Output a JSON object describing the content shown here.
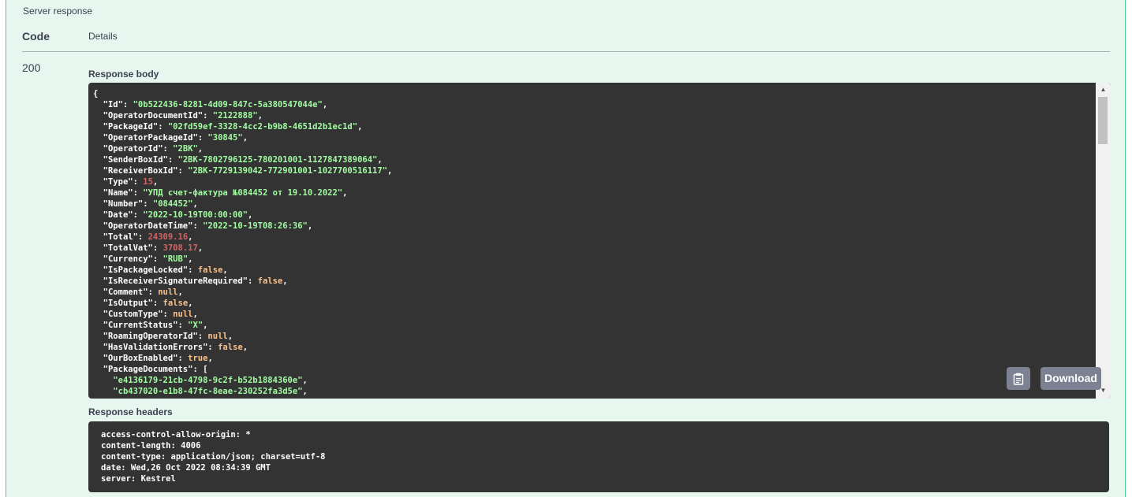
{
  "server_response": {
    "title": "Server response",
    "col_code": "Code",
    "col_details": "Details"
  },
  "response": {
    "code": "200",
    "body_label": "Response body",
    "headers_label": "Response headers",
    "download_label": "Download",
    "copy_icon": "clipboard-icon",
    "body_lines": [
      [
        {
          "t": "p",
          "v": "{"
        }
      ],
      [
        {
          "t": "p",
          "v": "  "
        },
        {
          "t": "k",
          "v": "\"Id\""
        },
        {
          "t": "p",
          "v": ": "
        },
        {
          "t": "s",
          "v": "\"0b522436-8281-4d09-847c-5a380547044e\""
        },
        {
          "t": "p",
          "v": ","
        }
      ],
      [
        {
          "t": "p",
          "v": "  "
        },
        {
          "t": "k",
          "v": "\"OperatorDocumentId\""
        },
        {
          "t": "p",
          "v": ": "
        },
        {
          "t": "s",
          "v": "\"2122888\""
        },
        {
          "t": "p",
          "v": ","
        }
      ],
      [
        {
          "t": "p",
          "v": "  "
        },
        {
          "t": "k",
          "v": "\"PackageId\""
        },
        {
          "t": "p",
          "v": ": "
        },
        {
          "t": "s",
          "v": "\"02fd59ef-3328-4cc2-b9b8-4651d2b1ec1d\""
        },
        {
          "t": "p",
          "v": ","
        }
      ],
      [
        {
          "t": "p",
          "v": "  "
        },
        {
          "t": "k",
          "v": "\"OperatorPackageId\""
        },
        {
          "t": "p",
          "v": ": "
        },
        {
          "t": "s",
          "v": "\"30845\""
        },
        {
          "t": "p",
          "v": ","
        }
      ],
      [
        {
          "t": "p",
          "v": "  "
        },
        {
          "t": "k",
          "v": "\"OperatorId\""
        },
        {
          "t": "p",
          "v": ": "
        },
        {
          "t": "s",
          "v": "\"2BK\""
        },
        {
          "t": "p",
          "v": ","
        }
      ],
      [
        {
          "t": "p",
          "v": "  "
        },
        {
          "t": "k",
          "v": "\"SenderBoxId\""
        },
        {
          "t": "p",
          "v": ": "
        },
        {
          "t": "s",
          "v": "\"2BK-7802796125-780201001-1127847389064\""
        },
        {
          "t": "p",
          "v": ","
        }
      ],
      [
        {
          "t": "p",
          "v": "  "
        },
        {
          "t": "k",
          "v": "\"ReceiverBoxId\""
        },
        {
          "t": "p",
          "v": ": "
        },
        {
          "t": "s",
          "v": "\"2BK-7729139042-772901001-1027700516117\""
        },
        {
          "t": "p",
          "v": ","
        }
      ],
      [
        {
          "t": "p",
          "v": "  "
        },
        {
          "t": "k",
          "v": "\"Type\""
        },
        {
          "t": "p",
          "v": ": "
        },
        {
          "t": "n",
          "v": "15"
        },
        {
          "t": "p",
          "v": ","
        }
      ],
      [
        {
          "t": "p",
          "v": "  "
        },
        {
          "t": "k",
          "v": "\"Name\""
        },
        {
          "t": "p",
          "v": ": "
        },
        {
          "t": "s",
          "v": "\"УПД счет-фактура №084452 от 19.10.2022\""
        },
        {
          "t": "p",
          "v": ","
        }
      ],
      [
        {
          "t": "p",
          "v": "  "
        },
        {
          "t": "k",
          "v": "\"Number\""
        },
        {
          "t": "p",
          "v": ": "
        },
        {
          "t": "s",
          "v": "\"084452\""
        },
        {
          "t": "p",
          "v": ","
        }
      ],
      [
        {
          "t": "p",
          "v": "  "
        },
        {
          "t": "k",
          "v": "\"Date\""
        },
        {
          "t": "p",
          "v": ": "
        },
        {
          "t": "s",
          "v": "\"2022-10-19T00:00:00\""
        },
        {
          "t": "p",
          "v": ","
        }
      ],
      [
        {
          "t": "p",
          "v": "  "
        },
        {
          "t": "k",
          "v": "\"OperatorDateTime\""
        },
        {
          "t": "p",
          "v": ": "
        },
        {
          "t": "s",
          "v": "\"2022-10-19T08:26:36\""
        },
        {
          "t": "p",
          "v": ","
        }
      ],
      [
        {
          "t": "p",
          "v": "  "
        },
        {
          "t": "k",
          "v": "\"Total\""
        },
        {
          "t": "p",
          "v": ": "
        },
        {
          "t": "n",
          "v": "24309.16"
        },
        {
          "t": "p",
          "v": ","
        }
      ],
      [
        {
          "t": "p",
          "v": "  "
        },
        {
          "t": "k",
          "v": "\"TotalVat\""
        },
        {
          "t": "p",
          "v": ": "
        },
        {
          "t": "n",
          "v": "3708.17"
        },
        {
          "t": "p",
          "v": ","
        }
      ],
      [
        {
          "t": "p",
          "v": "  "
        },
        {
          "t": "k",
          "v": "\"Currency\""
        },
        {
          "t": "p",
          "v": ": "
        },
        {
          "t": "s",
          "v": "\"RUB\""
        },
        {
          "t": "p",
          "v": ","
        }
      ],
      [
        {
          "t": "p",
          "v": "  "
        },
        {
          "t": "k",
          "v": "\"IsPackageLocked\""
        },
        {
          "t": "p",
          "v": ": "
        },
        {
          "t": "l",
          "v": "false"
        },
        {
          "t": "p",
          "v": ","
        }
      ],
      [
        {
          "t": "p",
          "v": "  "
        },
        {
          "t": "k",
          "v": "\"IsReceiverSignatureRequired\""
        },
        {
          "t": "p",
          "v": ": "
        },
        {
          "t": "l",
          "v": "false"
        },
        {
          "t": "p",
          "v": ","
        }
      ],
      [
        {
          "t": "p",
          "v": "  "
        },
        {
          "t": "k",
          "v": "\"Comment\""
        },
        {
          "t": "p",
          "v": ": "
        },
        {
          "t": "l",
          "v": "null"
        },
        {
          "t": "p",
          "v": ","
        }
      ],
      [
        {
          "t": "p",
          "v": "  "
        },
        {
          "t": "k",
          "v": "\"IsOutput\""
        },
        {
          "t": "p",
          "v": ": "
        },
        {
          "t": "l",
          "v": "false"
        },
        {
          "t": "p",
          "v": ","
        }
      ],
      [
        {
          "t": "p",
          "v": "  "
        },
        {
          "t": "k",
          "v": "\"CustomType\""
        },
        {
          "t": "p",
          "v": ": "
        },
        {
          "t": "l",
          "v": "null"
        },
        {
          "t": "p",
          "v": ","
        }
      ],
      [
        {
          "t": "p",
          "v": "  "
        },
        {
          "t": "k",
          "v": "\"CurrentStatus\""
        },
        {
          "t": "p",
          "v": ": "
        },
        {
          "t": "s",
          "v": "\"X\""
        },
        {
          "t": "p",
          "v": ","
        }
      ],
      [
        {
          "t": "p",
          "v": "  "
        },
        {
          "t": "k",
          "v": "\"RoamingOperatorId\""
        },
        {
          "t": "p",
          "v": ": "
        },
        {
          "t": "l",
          "v": "null"
        },
        {
          "t": "p",
          "v": ","
        }
      ],
      [
        {
          "t": "p",
          "v": "  "
        },
        {
          "t": "k",
          "v": "\"HasValidationErrors\""
        },
        {
          "t": "p",
          "v": ": "
        },
        {
          "t": "l",
          "v": "false"
        },
        {
          "t": "p",
          "v": ","
        }
      ],
      [
        {
          "t": "p",
          "v": "  "
        },
        {
          "t": "k",
          "v": "\"OurBoxEnabled\""
        },
        {
          "t": "p",
          "v": ": "
        },
        {
          "t": "l",
          "v": "true"
        },
        {
          "t": "p",
          "v": ","
        }
      ],
      [
        {
          "t": "p",
          "v": "  "
        },
        {
          "t": "k",
          "v": "\"PackageDocuments\""
        },
        {
          "t": "p",
          "v": ": ["
        }
      ],
      [
        {
          "t": "p",
          "v": "    "
        },
        {
          "t": "s",
          "v": "\"e4136179-21cb-4798-9c2f-b52b1884360e\""
        },
        {
          "t": "p",
          "v": ","
        }
      ],
      [
        {
          "t": "p",
          "v": "    "
        },
        {
          "t": "s",
          "v": "\"cb437020-e1b8-47fc-8eae-230252fa3d5e\""
        },
        {
          "t": "p",
          "v": ","
        }
      ]
    ],
    "headers": [
      "access-control-allow-origin: *",
      "content-length: 4006",
      "content-type: application/json; charset=utf-8",
      "date: Wed,26 Oct 2022 08:34:39 GMT",
      "server: Kestrel"
    ]
  },
  "colors": {
    "panel_bg": "#e8f6f0",
    "panel_border": "#49cc90",
    "code_bg": "#333333",
    "json_string": "#a2fca2",
    "json_number": "#d36363",
    "json_literal": "#fcc28c",
    "button_bg": "#7d8293"
  }
}
